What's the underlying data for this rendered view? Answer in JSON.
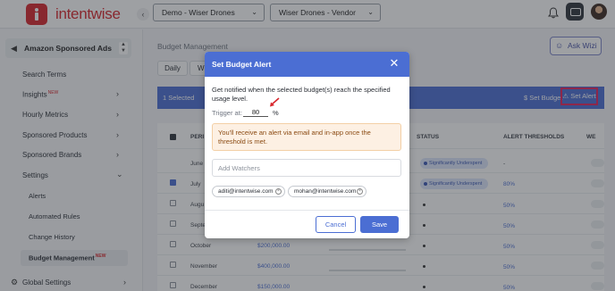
{
  "brand": {
    "name": "intentwise"
  },
  "header": {
    "collapse_icon": "‹",
    "account_select": "Demo - Wiser Drones",
    "profile_select": "Wiser Drones - Vendor"
  },
  "sidebar": {
    "section": "Amazon Sponsored Ads",
    "items": [
      {
        "label": "Search Terms"
      },
      {
        "label": "Insights",
        "badge": "NEW"
      },
      {
        "label": "Hourly Metrics"
      },
      {
        "label": "Sponsored Products"
      },
      {
        "label": "Sponsored Brands"
      },
      {
        "label": "Settings"
      }
    ],
    "settings_items": [
      {
        "label": "Alerts"
      },
      {
        "label": "Automated Rules"
      },
      {
        "label": "Change History"
      },
      {
        "label": "Budget Management",
        "badge": "NEW"
      }
    ],
    "footer": "Global Settings"
  },
  "main": {
    "title": "Budget Management",
    "ask_wizi": "Ask Wizi",
    "tabs": [
      "Daily",
      "W"
    ],
    "selection_bar": {
      "selected": "1 Selected",
      "set_budget": "Set Budget",
      "set_alert": "Set Alert"
    },
    "table": {
      "headers": [
        "PERI",
        "STATUS",
        "ALERT THRESHOLDS",
        "WE"
      ],
      "rows": [
        {
          "period": "June",
          "amount": "",
          "status": "Significantly Underspent",
          "threshold": "-",
          "checked": false
        },
        {
          "period": "July",
          "amount": "",
          "status": "Significantly Underspent",
          "threshold": "80%",
          "checked": true
        },
        {
          "period": "Augu",
          "amount": "",
          "status": "-",
          "threshold": "50%",
          "checked": false
        },
        {
          "period": "Septe",
          "amount": "",
          "status": "-",
          "threshold": "50%",
          "checked": false
        },
        {
          "period": "October",
          "amount": "$200,000.00",
          "status": "-",
          "threshold": "50%",
          "checked": false
        },
        {
          "period": "November",
          "amount": "$400,000.00",
          "status": "-",
          "threshold": "50%",
          "checked": false
        },
        {
          "period": "December",
          "amount": "$150,000.00",
          "status": "-",
          "threshold": "50%",
          "checked": false
        }
      ]
    }
  },
  "modal": {
    "title": "Set Budget Alert",
    "description": "Get notified when the selected budget(s) reach the specified usage level.",
    "trigger_label": "Trigger at:",
    "trigger_value": "80",
    "trigger_unit": "%",
    "info": "You'll receive an alert via email and in-app once the threshold is met.",
    "watchers_placeholder": "Add Watchers",
    "watchers": [
      "aditi@intentwise.com",
      "mohan@intentwise.com"
    ],
    "cancel": "Cancel",
    "save": "Save"
  },
  "colors": {
    "brand_red": "#d8262c",
    "primary_blue": "#4b6ed3",
    "highlight": "#e0245e",
    "info_bg": "#fdf0e3"
  },
  "icons": [
    "logo-icon",
    "bell-icon",
    "chat-icon",
    "megaphone-icon",
    "chevron-right-icon",
    "chevron-down-icon",
    "globe-icon",
    "close-icon",
    "arrow-icon",
    "alert-icon"
  ]
}
